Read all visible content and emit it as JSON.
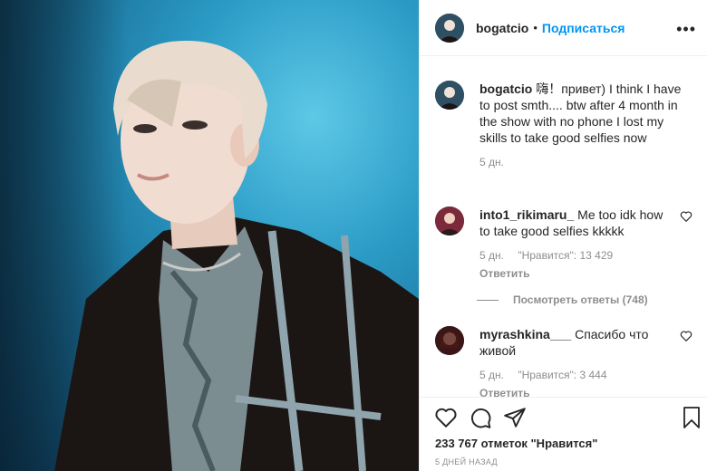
{
  "post": {
    "username": "bogatcio",
    "follow_label": "Подписаться",
    "more_icon": "ellipsis-icon"
  },
  "caption": {
    "username": "bogatcio",
    "text": "嗨！привет) I think I have to post smth.... btw after 4 month in the show with no phone I lost my skills to take good selfies now",
    "time": "5 дн."
  },
  "comments": [
    {
      "username": "into1_rikimaru_",
      "text": "Me too idk how to take good selfies kkkkk",
      "time": "5 дн.",
      "likes": "\"Нравится\": 13 429",
      "reply_label": "Ответить"
    },
    {
      "username": "myrashkina___",
      "text": "Спасибо что живой",
      "time": "5 дн.",
      "likes": "\"Нравится\": 3 444",
      "reply_label": "Ответить"
    }
  ],
  "view_replies": "Посмотреть ответы (748)",
  "likes_text": "233 767 отметок \"Нравится\"",
  "posted_time": "5 ДНЕЙ НАЗАД",
  "colors": {
    "link": "#0095f6",
    "muted": "#8e8e8e",
    "text": "#262626",
    "photo_bg": "#2b9bc6"
  }
}
